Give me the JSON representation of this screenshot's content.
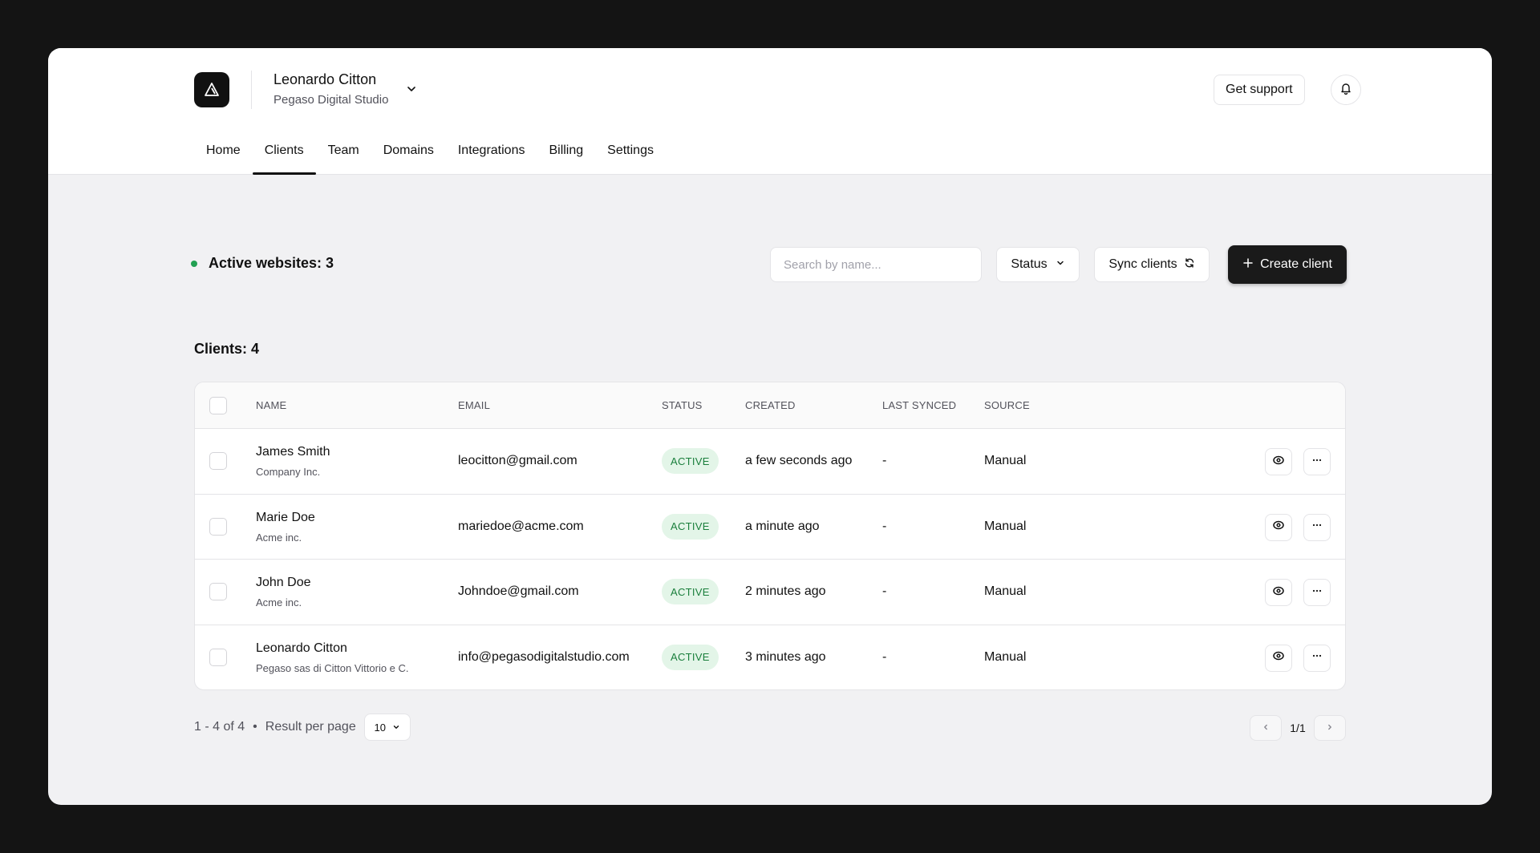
{
  "account": {
    "name": "Leonardo Citton",
    "org": "Pegaso Digital Studio"
  },
  "header": {
    "support_label": "Get support"
  },
  "nav": {
    "items": [
      {
        "label": "Home"
      },
      {
        "label": "Clients"
      },
      {
        "label": "Team"
      },
      {
        "label": "Domains"
      },
      {
        "label": "Integrations"
      },
      {
        "label": "Billing"
      },
      {
        "label": "Settings"
      }
    ],
    "active": "Clients"
  },
  "summary": {
    "text": "Active websites: 3",
    "status_color": "#22a052"
  },
  "toolbar": {
    "search_placeholder": "Search by name...",
    "status_label": "Status",
    "sync_label": "Sync clients",
    "create_label": "Create client"
  },
  "clients": {
    "title": "Clients: 4",
    "columns": [
      "NAME",
      "EMAIL",
      "STATUS",
      "CREATED",
      "LAST SYNCED",
      "SOURCE"
    ],
    "rows": [
      {
        "name": "James Smith",
        "company": "Company Inc.",
        "email": "leocitton@gmail.com",
        "status": "ACTIVE",
        "created": "a few seconds ago",
        "last_synced": "-",
        "source": "Manual"
      },
      {
        "name": "Marie Doe",
        "company": "Acme inc.",
        "email": "mariedoe@acme.com",
        "status": "ACTIVE",
        "created": "a minute ago",
        "last_synced": "-",
        "source": "Manual"
      },
      {
        "name": "John Doe",
        "company": "Acme inc.",
        "email": "Johndoe@gmail.com",
        "status": "ACTIVE",
        "created": "2 minutes ago",
        "last_synced": "-",
        "source": "Manual"
      },
      {
        "name": "Leonardo Citton",
        "company": "Pegaso sas di Citton Vittorio e C.",
        "email": "info@pegasodigitalstudio.com",
        "status": "ACTIVE",
        "created": "3 minutes ago",
        "last_synced": "-",
        "source": "Manual"
      }
    ]
  },
  "pagination": {
    "range": "1 - 4 of 4",
    "bullet": "•",
    "per_page_label": "Result per page",
    "per_page_value": "10",
    "page_indicator": "1/1"
  },
  "colors": {
    "accent": "#1a1a1a",
    "badge_bg": "#e3f5e8",
    "badge_text": "#1a7f3c"
  },
  "icons": {
    "logo": "triangle-logo-icon",
    "account_menu": "chevron-down-icon",
    "notifications": "bell-icon",
    "sync": "refresh-icon",
    "create": "plus-icon",
    "view": "eye-icon",
    "more": "more-horizontal-icon",
    "prev": "chevron-left-icon",
    "next": "chevron-right-icon"
  }
}
